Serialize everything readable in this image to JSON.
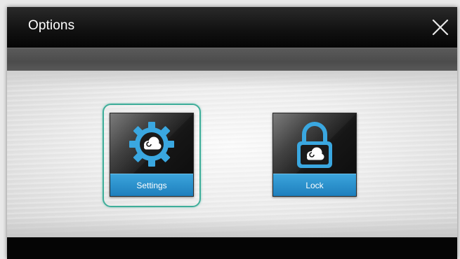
{
  "dialog": {
    "title": "Options",
    "close_icon": "close-icon"
  },
  "tiles": [
    {
      "label": "Settings",
      "icon": "gear-cloud-icon",
      "focused": true
    },
    {
      "label": "Lock",
      "icon": "padlock-cloud-icon",
      "focused": false
    }
  ],
  "colors": {
    "accent_blue": "#2a8fd0",
    "icon_blue": "#3aa7e0",
    "focus_ring": "#3fae9a",
    "titlebar": "#111111"
  }
}
